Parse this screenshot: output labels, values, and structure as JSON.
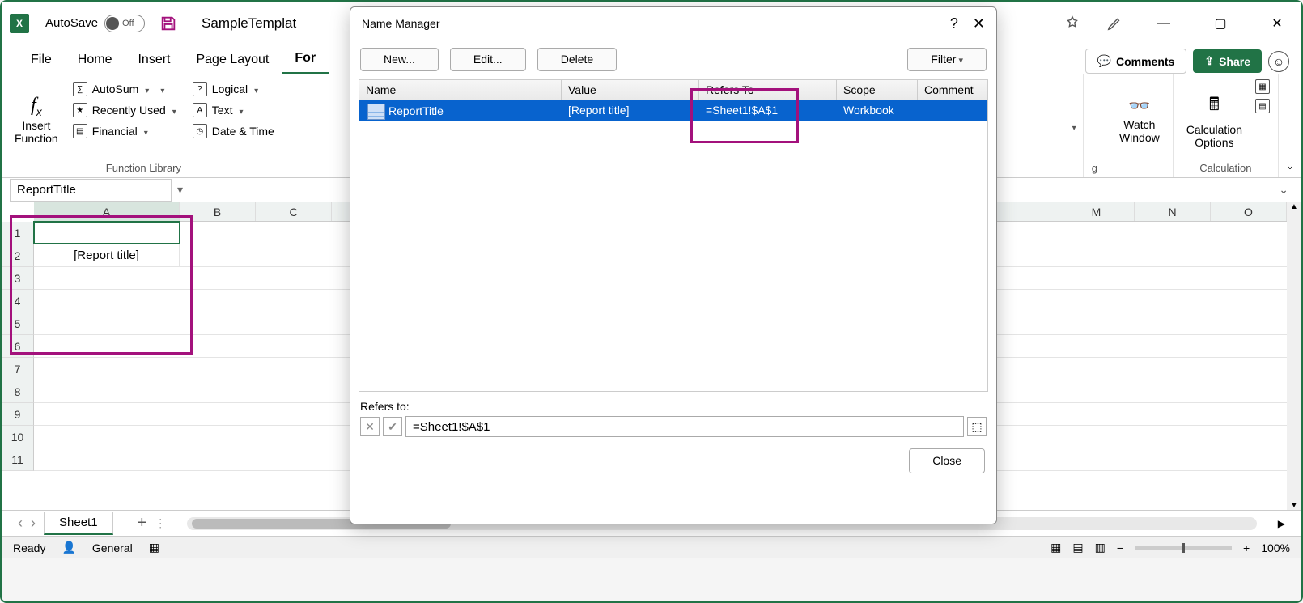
{
  "titlebar": {
    "autosave_label": "AutoSave",
    "autosave_state": "Off",
    "doc_title": "SampleTemplat",
    "window_buttons": {
      "min": "—",
      "max": "▢",
      "close": "✕"
    }
  },
  "tabs": {
    "file": "File",
    "home": "Home",
    "insert": "Insert",
    "page_layout": "Page Layout",
    "formulas": "For",
    "active": "formulas"
  },
  "ribbon_right": {
    "comments": "Comments",
    "share": "Share"
  },
  "ribbon": {
    "insert_function": "Insert\nFunction",
    "autosum": "AutoSum",
    "recently_used": "Recently Used",
    "financial": "Financial",
    "logical": "Logical",
    "text": "Text",
    "date_time": "Date & Time",
    "group_function_library": "Function Library",
    "watch_window": "Watch\nWindow",
    "calc_options": "Calculation\nOptions",
    "group_calculation": "Calculation",
    "truncated_g": "g"
  },
  "name_box": "ReportTitle",
  "grid": {
    "columns": [
      "A",
      "B",
      "C",
      "M",
      "N",
      "O"
    ],
    "rows": [
      "1",
      "2",
      "3",
      "4",
      "5",
      "6",
      "7",
      "8",
      "9",
      "10",
      "11"
    ],
    "a2_value": "[Report title]"
  },
  "sheet_tabs": {
    "prev": "‹",
    "next": "›",
    "sheet1": "Sheet1",
    "add": "+"
  },
  "statusbar": {
    "ready": "Ready",
    "general": "General",
    "zoom": "100%",
    "minus": "−",
    "plus": "+"
  },
  "dialog": {
    "title": "Name Manager",
    "help": "?",
    "close_x": "✕",
    "buttons": {
      "new": "New...",
      "edit": "Edit...",
      "delete": "Delete",
      "filter": "Filter"
    },
    "columns": {
      "name": "Name",
      "value": "Value",
      "refers_to": "Refers To",
      "scope": "Scope",
      "comment": "Comment"
    },
    "rows": [
      {
        "name": "ReportTitle",
        "value": "[Report title]",
        "refers_to": "=Sheet1!$A$1",
        "scope": "Workbook",
        "comment": ""
      }
    ],
    "refers_to_label": "Refers to:",
    "refers_to_value": "=Sheet1!$A$1",
    "cancel_x": "✕",
    "confirm_chk": "✔",
    "close": "Close"
  }
}
